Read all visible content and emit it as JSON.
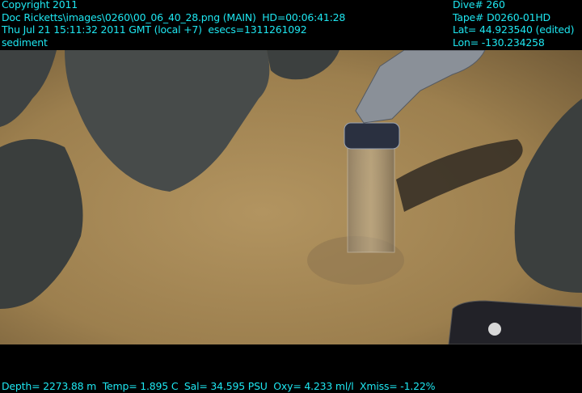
{
  "overlay_top_left": {
    "copyright": "Copyright 2011",
    "source": "Doc Ricketts\\images\\0260\\00_06_40_28.png (MAIN)  HD=00:06:41:28",
    "datetime": "Thu Jul 21 15:11:32 2011 GMT (local +7)  esecs=1311261092",
    "label": "sediment"
  },
  "overlay_top_right": {
    "dive": "Dive# 260",
    "tape": "Tape# D0260-01HD",
    "lat": "Lat= 44.923540 (edited)",
    "lon": "Lon= -130.234258"
  },
  "overlay_bottom": {
    "sensors": "Depth= 2273.88 m  Temp= 1.895 C  Sal= 34.595 PSU  Oxy= 4.233 ml/l  Xmiss= -1.22%"
  },
  "colors": {
    "overlay_text": "#1ee6f0",
    "sediment": "#a88a55",
    "rock": "#3f4444"
  }
}
